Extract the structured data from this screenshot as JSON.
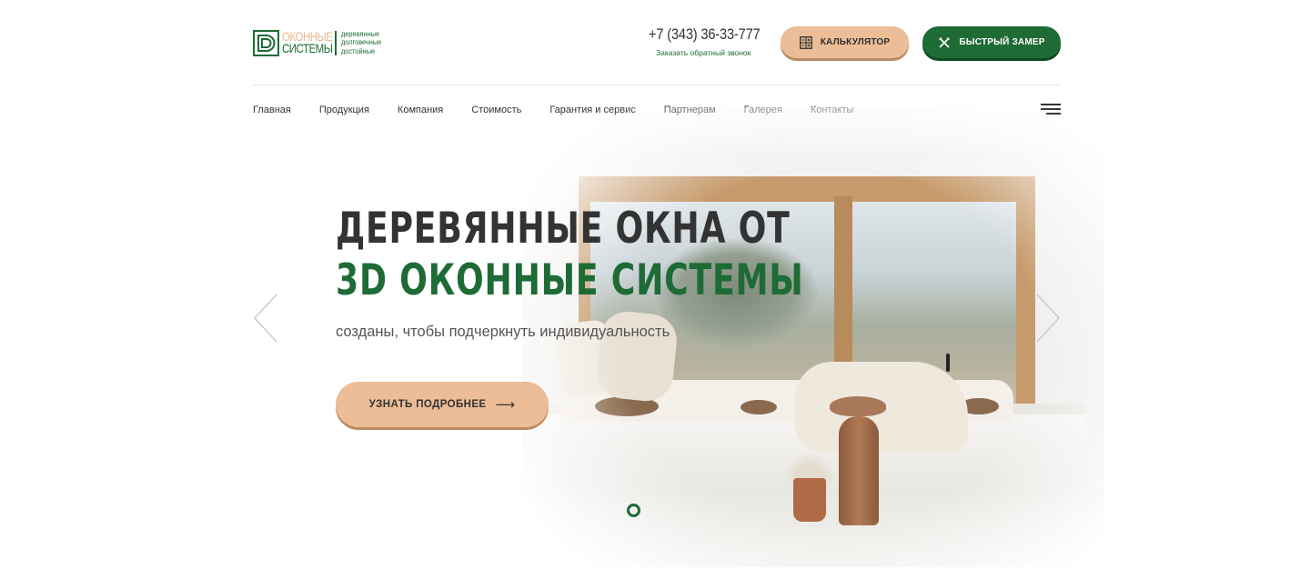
{
  "header": {
    "logo": {
      "name_line1": "ОКОННЫЕ",
      "name_line2": "СИСТЕМЫ",
      "tagline": [
        "деревянные",
        "долговечные",
        "достойные"
      ]
    },
    "phone": "+7 (343) 36-33-777",
    "callback_label": "Заказать обратный звонок",
    "calculator_label": "КАЛЬКУЛЯТОР",
    "quick_measure_label": "БЫСТРЫЙ ЗАМЕР"
  },
  "nav": {
    "items": [
      "Главная",
      "Продукция",
      "Компания",
      "Стоимость",
      "Гарантия и сервис",
      "Партнерам",
      "Галерея",
      "Контакты"
    ],
    "menu_icon": "hamburger-menu-icon"
  },
  "hero": {
    "title_line1": "ДЕРЕВЯННЫЕ ОКНА ОТ",
    "title_line2": "3D ОКОННЫЕ СИСТЕМЫ",
    "subtitle": "созданы, чтобы подчеркнуть индивидуальность",
    "cta_label": "УЗНАТЬ ПОДРОБНЕЕ",
    "cta_icon": "arrow-right-icon"
  },
  "slider": {
    "prev_icon": "chevron-left-icon",
    "next_icon": "chevron-right-icon",
    "active_slide": 1,
    "total_slides": 1
  },
  "colors": {
    "brand_green": "#1e6b35",
    "accent_peach": "#ecbd96",
    "text_dark": "#333333",
    "logo_peach": "#e9b98d"
  }
}
